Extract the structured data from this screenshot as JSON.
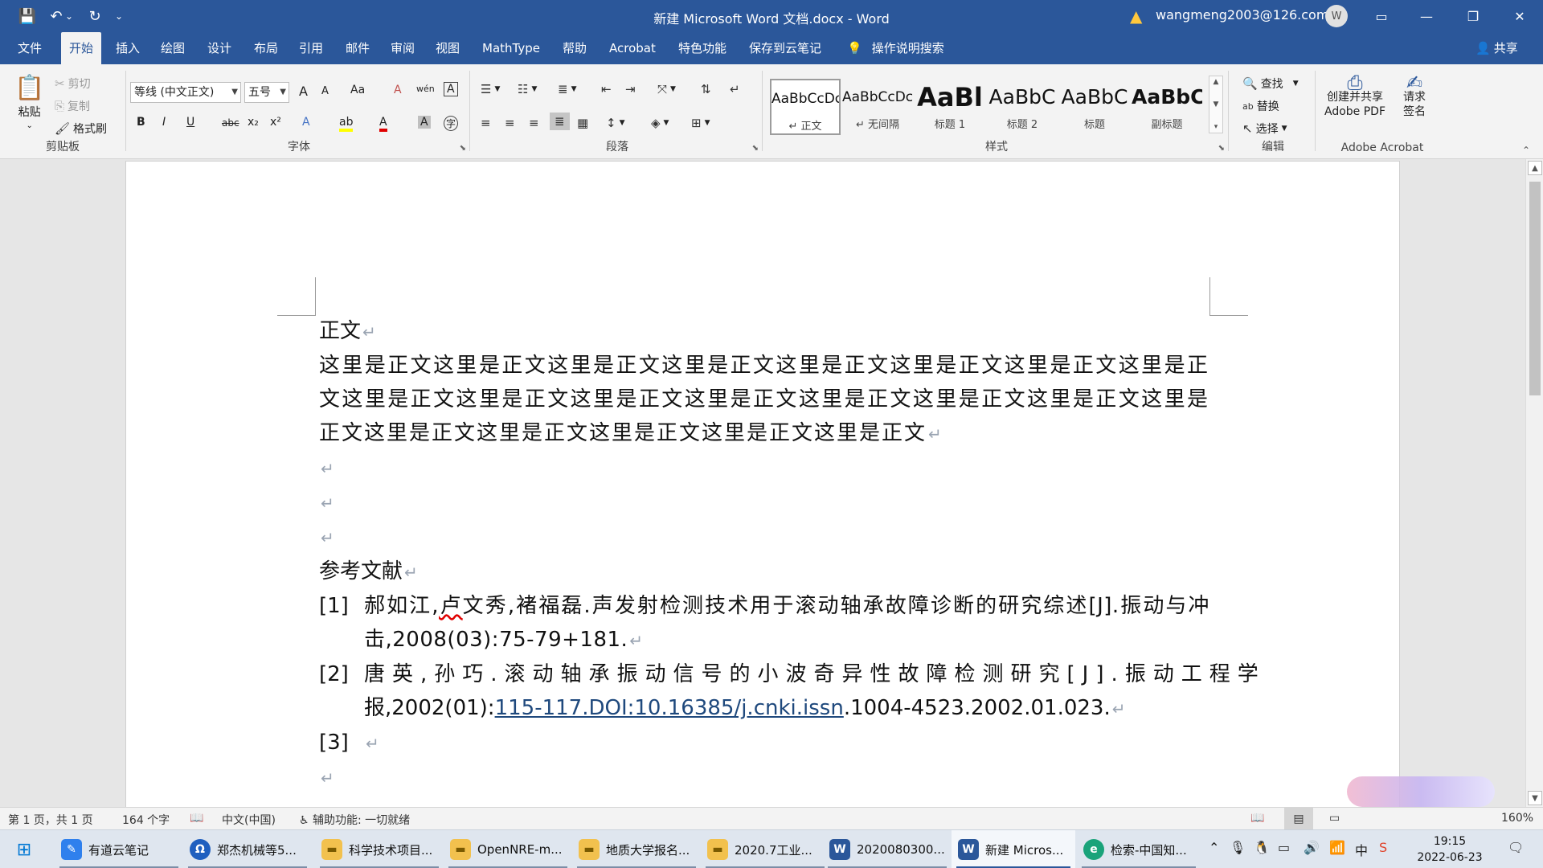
{
  "window": {
    "title": "新建 Microsoft Word 文档.docx - Word",
    "user": "wangmeng2003@126.com",
    "avatar_letter": "W"
  },
  "qat": {
    "save": "💾",
    "undo": "↶",
    "redo": "↻",
    "more": "⌄"
  },
  "window_controls": {
    "ribbon_display": "▭",
    "minimize": "—",
    "restore": "❐",
    "close": "✕"
  },
  "menu": {
    "tabs": [
      "文件",
      "开始",
      "插入",
      "绘图",
      "设计",
      "布局",
      "引用",
      "邮件",
      "审阅",
      "视图",
      "MathType",
      "帮助",
      "Acrobat",
      "特色功能",
      "保存到云笔记"
    ],
    "active_tab": "开始",
    "tell_me": "操作说明搜索",
    "share": "共享"
  },
  "ribbon": {
    "clipboard": {
      "paste": "粘贴",
      "cut": "剪切",
      "copy": "复制",
      "format_painter": "格式刷",
      "label": "剪贴板"
    },
    "font": {
      "font_name": "等线 (中文正文)",
      "font_size": "五号",
      "label": "字体",
      "btn": {
        "grow": "A",
        "shrink": "A",
        "case": "Aa",
        "clear": "A",
        "phonetic": "wén",
        "border": "A",
        "bold": "B",
        "italic": "I",
        "underline": "U",
        "strike": "abc",
        "sub": "x₂",
        "sup": "x²",
        "effects": "A",
        "highlight": "ab",
        "color": "A",
        "shading": "A",
        "enclose": "字"
      }
    },
    "paragraph": {
      "label": "段落"
    },
    "styles": {
      "label": "样式",
      "items": [
        {
          "preview": "AaBbCcDc",
          "name": "正文"
        },
        {
          "preview": "AaBbCcDc",
          "name": "无间隔"
        },
        {
          "preview": "AaBl",
          "name": "标题 1"
        },
        {
          "preview": "AaBbC",
          "name": "标题 2"
        },
        {
          "preview": "AaBbC",
          "name": "标题"
        },
        {
          "preview": "AaBbC",
          "name": "副标题"
        }
      ]
    },
    "editing": {
      "find": "查找",
      "replace": "替换",
      "select": "选择",
      "label": "编辑"
    },
    "acrobat": {
      "create_pdf_1": "创建并共享",
      "create_pdf_2": "Adobe PDF",
      "request_1": "请求",
      "request_2": "签名",
      "label": "Adobe Acrobat"
    }
  },
  "document": {
    "heading": "正文",
    "paragraph": "这里是正文这里是正文这里是正文这里是正文这里是正文这里是正文这里是正文这里是正文这里是正文这里是正文这里是正文这里是正文这里是正文这里是正文这里是正文这里是正文这里是正文这里是正文这里是正文这里是正文这里是正文",
    "refs_title": "参考文献",
    "refs": {
      "r1_num": "[1]",
      "r1_pre": "郝如江,",
      "r1_squig": "卢",
      "r1_post": "文秀,褚福磊.声发射检测技术用于滚动轴承故障诊断的研究综述[J].振动与冲击,2008(03):75-79+181.",
      "r2_num": "[2]",
      "r2_a": "唐英,孙巧.滚动轴承振动信号的小波奇异性故障检测研究[J].振动工程学",
      "r2_b": "报,2002(01):",
      "r2_link": "115-117.DOI:10.16385/j.cnki.issn",
      "r2_c": ".1004-4523.2002.01.023.",
      "r3_num": "[3]"
    },
    "pmark": "↵"
  },
  "status": {
    "page": "第 1 页，共 1 页",
    "words": "164 个字",
    "language": "中文(中国)",
    "accessibility": "辅助功能: 一切就绪",
    "zoom": "160%"
  },
  "taskbar": {
    "items": [
      "有道云笔记",
      "郑杰机械等5...",
      "科学技术项目...",
      "OpenNRE-m...",
      "地质大学报名...",
      "2020.7工业...",
      "2020080300...",
      "新建 Micros...",
      "检索-中国知..."
    ],
    "time": "19:15",
    "date": "2022-06-23",
    "ime": "中"
  }
}
